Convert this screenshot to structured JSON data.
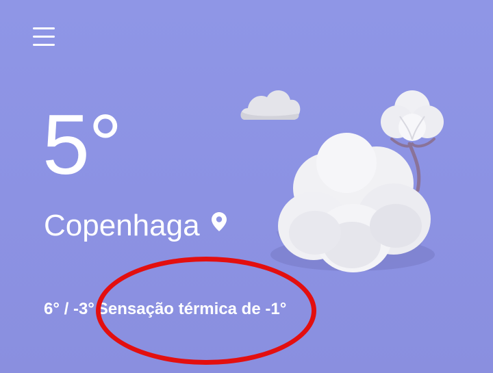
{
  "header": {
    "menu_icon": "hamburger-menu-icon"
  },
  "weather": {
    "temperature": "5°",
    "city": "Copenhaga",
    "location_icon": "location-pin-icon",
    "high_low": "6° / -3°",
    "feels_like": "Sensação térmica de -1°"
  },
  "illustration": {
    "icon": "cloudy-weather-illustration"
  },
  "colors": {
    "background": "#8f96e6",
    "text": "#ffffff",
    "annotation": "#e30f0f"
  }
}
